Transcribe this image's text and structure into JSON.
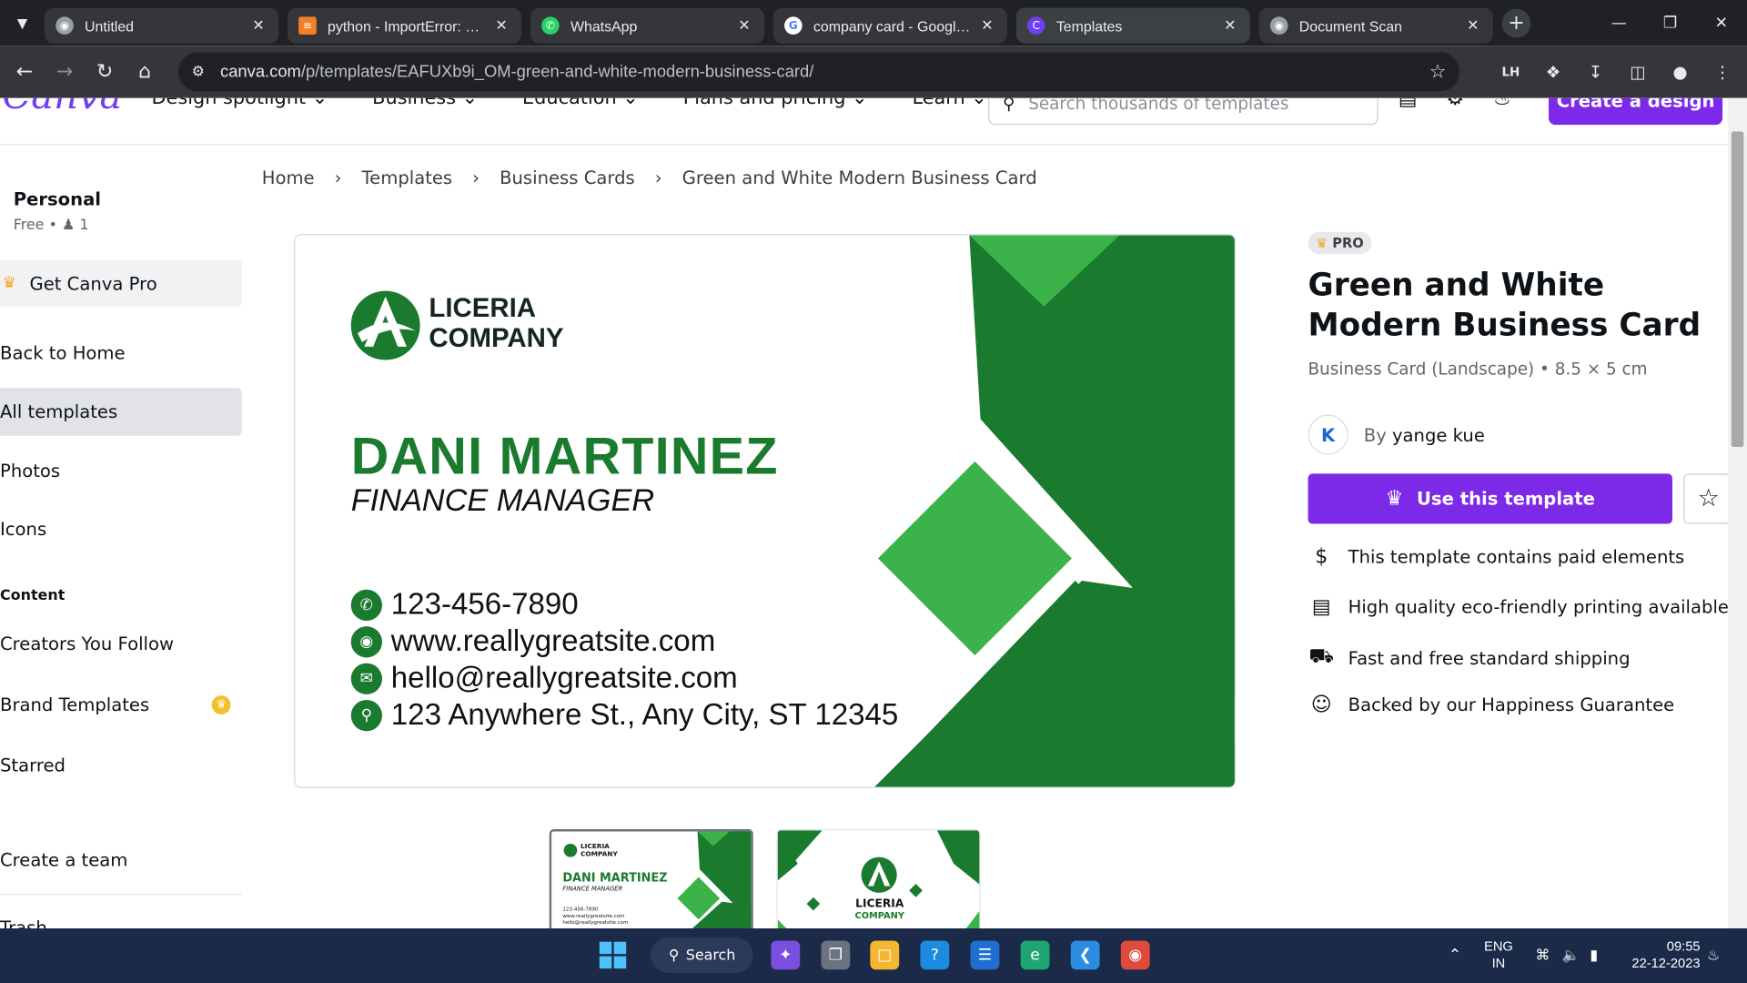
{
  "browser": {
    "tabs": [
      {
        "title": "Untitled",
        "favicon": "globe-icon",
        "active": false
      },
      {
        "title": "python - ImportError: No module named",
        "favicon": "stackoverflow-icon",
        "active": false
      },
      {
        "title": "WhatsApp",
        "favicon": "whatsapp-icon",
        "active": false
      },
      {
        "title": "company card - Google Search",
        "favicon": "google-icon",
        "active": false
      },
      {
        "title": "Templates",
        "favicon": "canva-icon",
        "active": true
      },
      {
        "title": "Document Scan",
        "favicon": "globe-icon",
        "active": false
      }
    ],
    "url_host": "canva.com",
    "url_path": "/p/templates/EAFUXb9i_OM-green-and-white-modern-business-card/"
  },
  "header": {
    "logo": "Canva",
    "menu": [
      "Design spotlight",
      "Business",
      "Education",
      "Plans and pricing",
      "Learn"
    ],
    "search_placeholder": "Search thousands of templates",
    "create_button": "Create a design"
  },
  "sidebar": {
    "account_name": "Personal",
    "account_plan": "Free",
    "member_count": "1",
    "get_pro": "Get Canva Pro",
    "items": [
      {
        "label": "Back to Home"
      },
      {
        "label": "All templates"
      },
      {
        "label": "Photos"
      },
      {
        "label": "Icons"
      }
    ],
    "content_section": "Content",
    "content_items": [
      {
        "label": "Creators You Follow"
      },
      {
        "label": "Brand Templates"
      },
      {
        "label": "Starred"
      }
    ],
    "create_team": "Create a team",
    "trash": "Trash"
  },
  "breadcrumb": [
    "Home",
    "Templates",
    "Business Cards",
    "Green and White Modern Business Card"
  ],
  "card": {
    "company_line1": "LICERIA",
    "company_line2": "COMPANY",
    "name": "DANI MARTINEZ",
    "title": "FINANCE MANAGER",
    "phone": "123-456-7890",
    "website": "www.reallygreatsite.com",
    "email": "hello@reallygreatsite.com",
    "address": "123 Anywhere St., Any City, ST 12345",
    "brand_green": "#1a7a2e",
    "accent_green": "#3bb34a"
  },
  "template": {
    "badge": "PRO",
    "title": "Green and White Modern Business Card",
    "subtitle": "Business Card (Landscape) • 8.5 × 5 cm",
    "author_prefix": "By",
    "author": "yange kue",
    "use_button": "Use this template",
    "features": [
      {
        "icon": "dollar-icon",
        "text": "This template contains paid elements"
      },
      {
        "icon": "printer-icon",
        "text": "High quality eco-friendly printing available"
      },
      {
        "icon": "truck-icon",
        "text": "Fast and free standard shipping"
      },
      {
        "icon": "smile-icon",
        "text": "Backed by our Happiness Guarantee"
      }
    ]
  },
  "thumbnails": {
    "front": {
      "company": "LICERIA COMPANY",
      "name": "DANI MARTINEZ",
      "title": "FINANCE MANAGER"
    },
    "back": {
      "company_line1": "LICERIA",
      "company_line2": "COMPANY"
    }
  },
  "taskbar": {
    "search": "Search",
    "lang_line1": "ENG",
    "lang_line2": "IN",
    "time": "09:55",
    "date": "22-12-2023"
  }
}
